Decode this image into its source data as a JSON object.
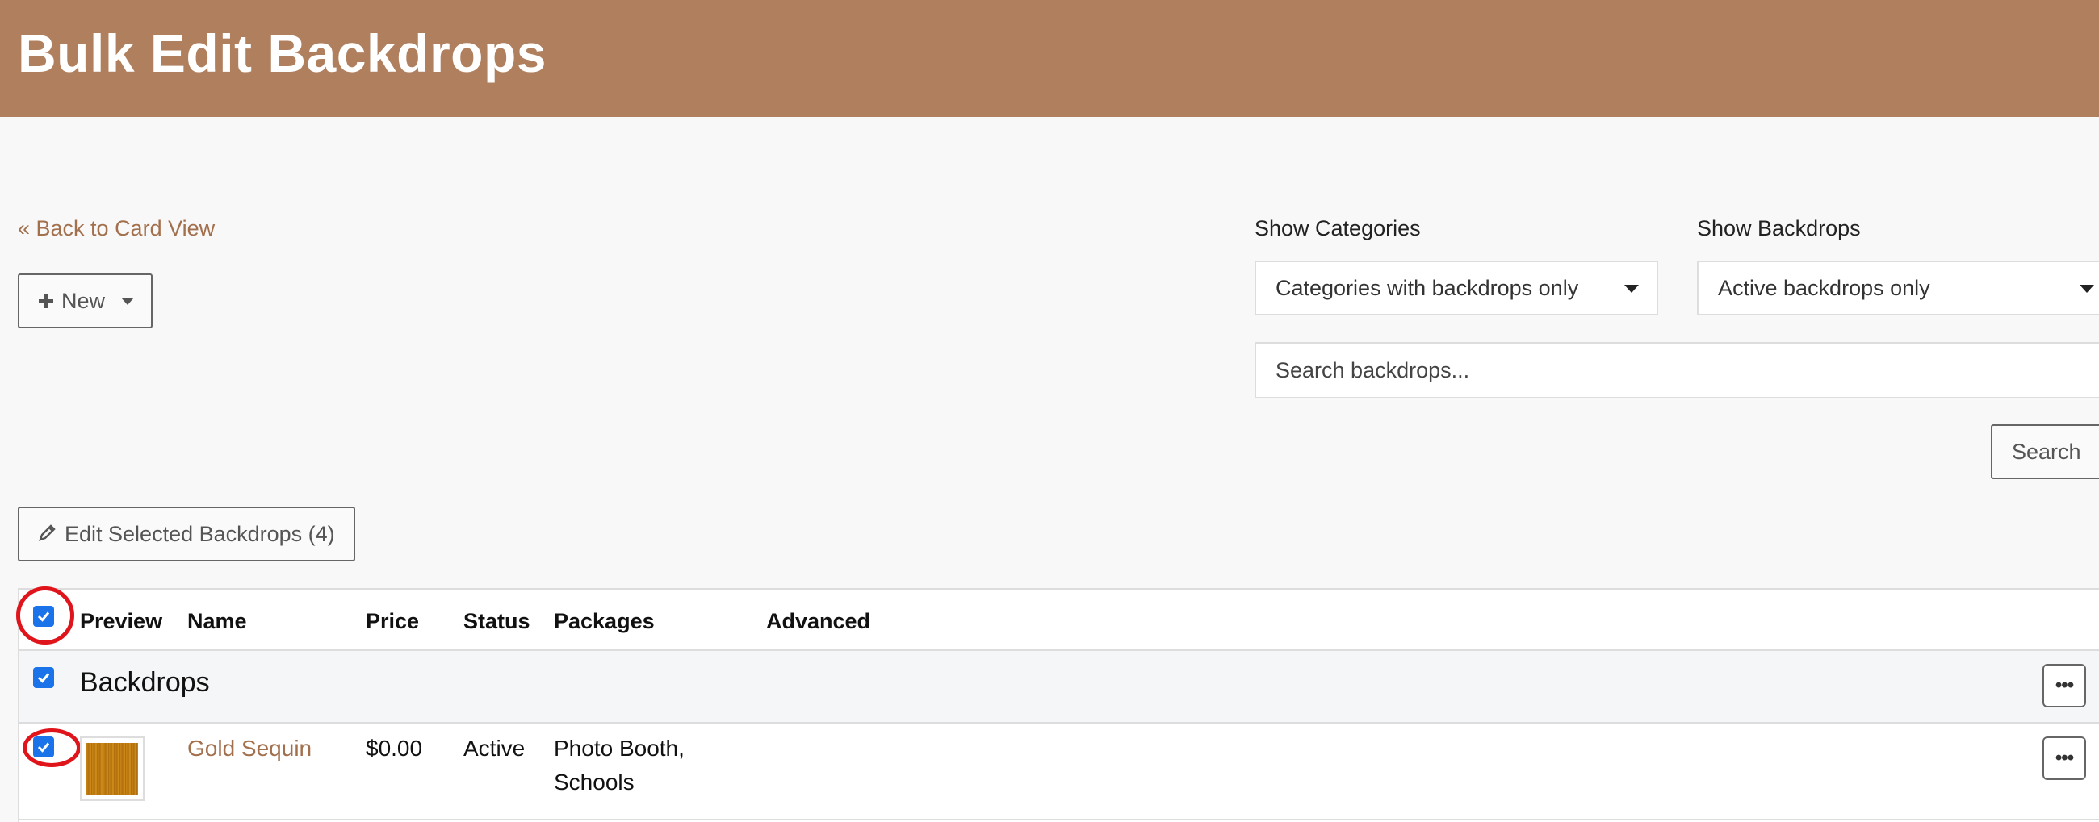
{
  "header": {
    "title": "Bulk Edit Backdrops"
  },
  "nav": {
    "back_link": "« Back to Card View"
  },
  "toolbar": {
    "new_label": "New",
    "edit_selected_label": "Edit Selected Backdrops (4)",
    "search_button": "Search"
  },
  "filters": {
    "categories_label": "Show Categories",
    "categories_value": "Categories with backdrops only",
    "backdrops_label": "Show Backdrops",
    "backdrops_value": "Active backdrops only",
    "search_placeholder": "Search backdrops..."
  },
  "table": {
    "columns": [
      "Preview",
      "Name",
      "Price",
      "Status",
      "Packages",
      "Advanced"
    ],
    "group": {
      "title": "Backdrops"
    },
    "rows": [
      {
        "name": "Gold Sequin",
        "price": "$0.00",
        "status": "Active",
        "packages_line1": "Photo Booth,",
        "packages_line2": "Schools",
        "checked": true
      }
    ]
  },
  "colors": {
    "header_bg": "#b07f5e",
    "link": "#a3704d",
    "checkbox": "#1a73e8",
    "highlight_ring": "#e0151b"
  },
  "icons": {
    "new": "plus-icon",
    "edit": "pencil-icon",
    "more": "ellipsis-icon",
    "check": "checkmark-icon"
  }
}
